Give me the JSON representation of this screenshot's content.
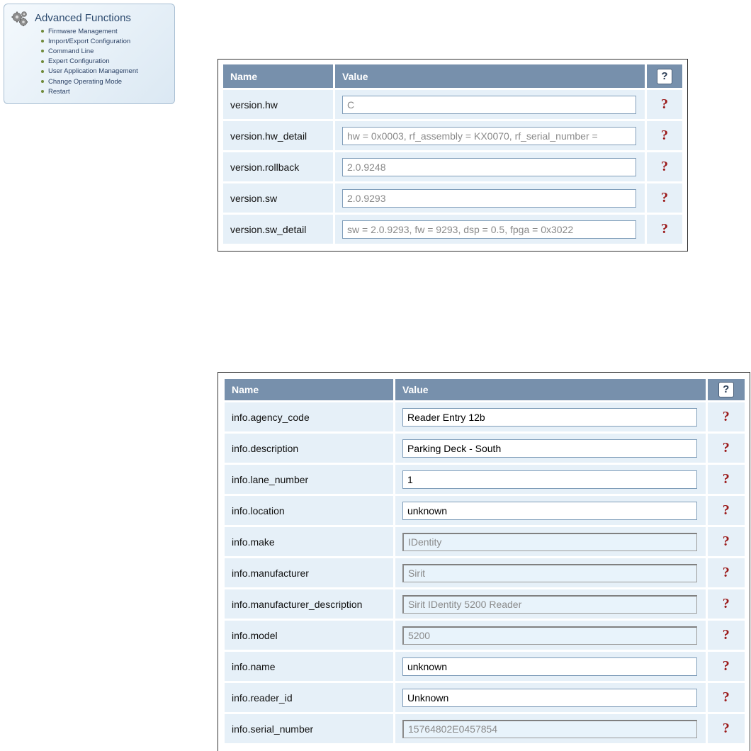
{
  "advanced": {
    "title": "Advanced Functions",
    "gear_icon": "gears-icon",
    "items": [
      "Firmware Management",
      "Import/Export Configuration",
      "Command Line",
      "Expert Configuration",
      "User Application Management",
      "Change Operating Mode",
      "Restart"
    ]
  },
  "version_table": {
    "headers": {
      "name": "Name",
      "value": "Value",
      "help": "?"
    },
    "rows": [
      {
        "name": "version.hw",
        "value": "C"
      },
      {
        "name": "version.hw_detail",
        "value": "hw = 0x0003, rf_assembly = KX0070, rf_serial_number = "
      },
      {
        "name": "version.rollback",
        "value": "2.0.9248"
      },
      {
        "name": "version.sw",
        "value": "2.0.9293"
      },
      {
        "name": "version.sw_detail",
        "value": "sw = 2.0.9293, fw = 9293, dsp = 0.5, fpga = 0x3022"
      }
    ],
    "help_mark": "?"
  },
  "info_table": {
    "headers": {
      "name": "Name",
      "value": "Value",
      "help": "?"
    },
    "rows": [
      {
        "name": "info.agency_code",
        "value": "Reader Entry 12b",
        "editable": true
      },
      {
        "name": "info.description",
        "value": "Parking Deck - South",
        "editable": true
      },
      {
        "name": "info.lane_number",
        "value": "1",
        "editable": true
      },
      {
        "name": "info.location",
        "value": "unknown",
        "editable": true
      },
      {
        "name": "info.make",
        "value": "IDentity",
        "editable": false
      },
      {
        "name": "info.manufacturer",
        "value": "Sirit",
        "editable": false
      },
      {
        "name": "info.manufacturer_description",
        "value": "Sirit IDentity 5200 Reader",
        "editable": false
      },
      {
        "name": "info.model",
        "value": "5200",
        "editable": false
      },
      {
        "name": "info.name",
        "value": "unknown",
        "editable": true
      },
      {
        "name": "info.reader_id",
        "value": "Unknown",
        "editable": true
      },
      {
        "name": "info.serial_number",
        "value": "15764802E0457854",
        "editable": false
      }
    ],
    "help_mark": "?"
  },
  "colors": {
    "header_bg": "#7790ac",
    "cell_bg": "#e6f0f8",
    "help_mark": "#9b1a1a",
    "panel_border": "#a9bfd3"
  }
}
